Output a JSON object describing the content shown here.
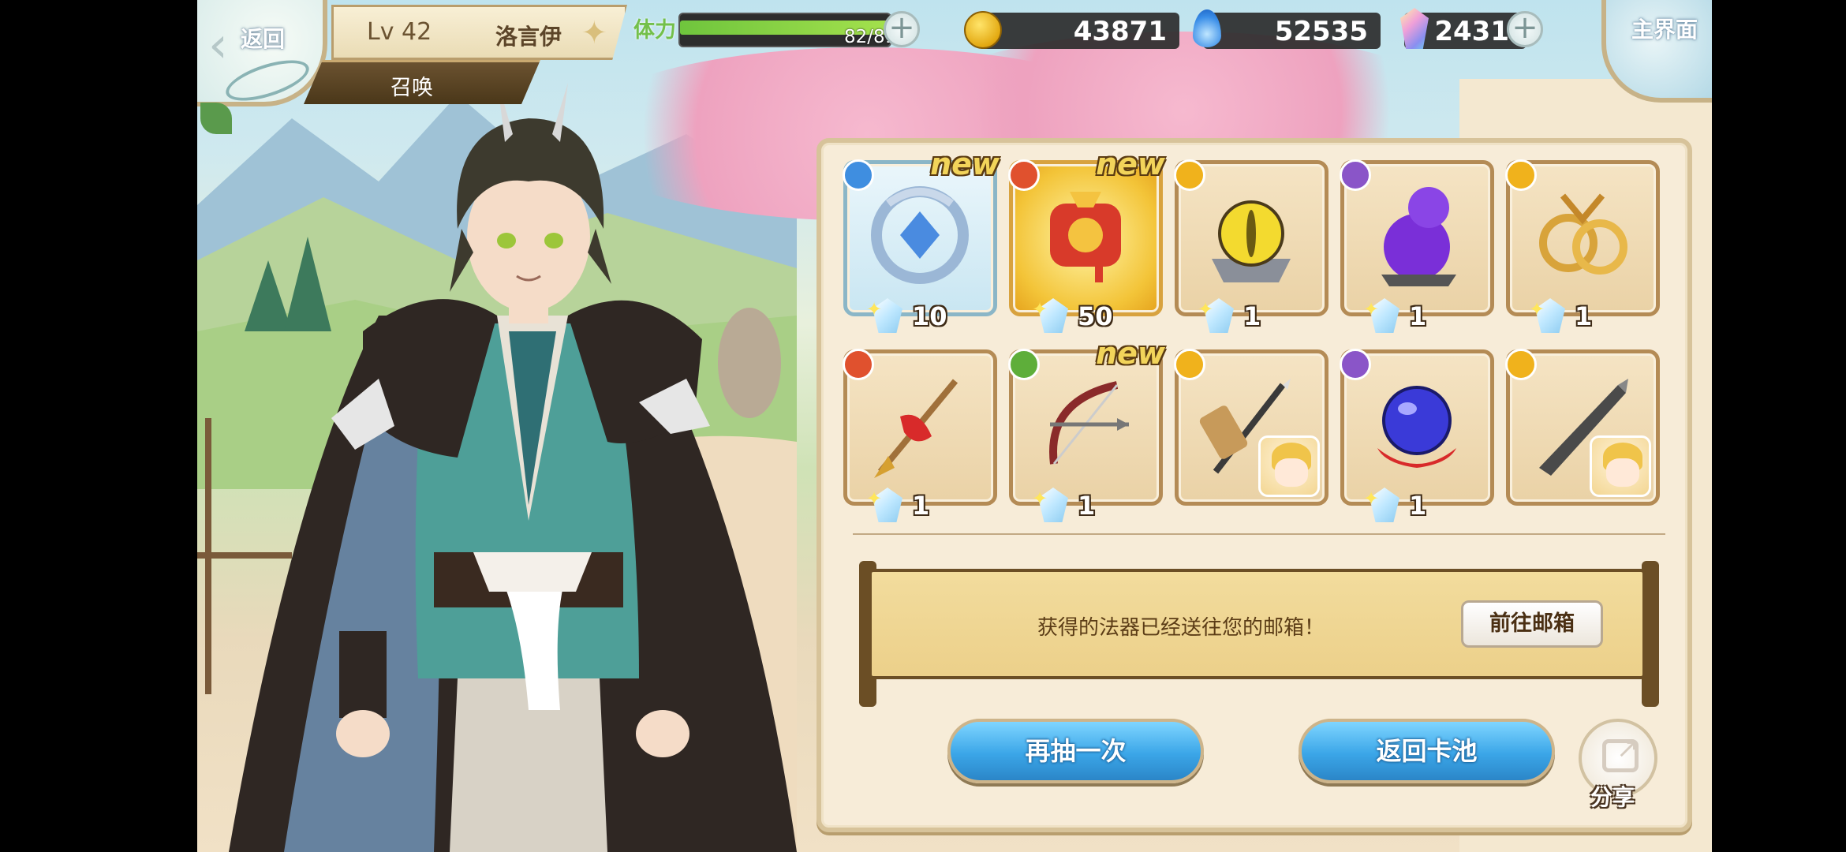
{
  "hud": {
    "back_label": "返回",
    "level": "Lv 42",
    "player_name": "洛言伊",
    "mode_tab": "召唤",
    "stamina_label": "体力",
    "stamina_value": "82/81",
    "stamina_fraction": 1.0,
    "gold": "43871",
    "spirit": "52535",
    "crystal": "2431",
    "home_label": "主界面"
  },
  "results": [
    {
      "qty": "10",
      "new": true,
      "new_label": "new",
      "element": "water",
      "element_color": "#3f8ee0",
      "icon": "dragon-ring-icon",
      "frame": "blue"
    },
    {
      "qty": "50",
      "new": true,
      "new_label": "new",
      "element": "fire",
      "element_color": "#e0512e",
      "icon": "red-scroll-icon",
      "frame": "gold"
    },
    {
      "qty": "1",
      "new": false,
      "new_label": "",
      "element": "light",
      "element_color": "#f0b21c",
      "icon": "yellow-orb-icon",
      "frame": "normal"
    },
    {
      "qty": "1",
      "new": false,
      "new_label": "",
      "element": "dark",
      "element_color": "#8a55c8",
      "icon": "purple-gourd-icon",
      "frame": "normal"
    },
    {
      "qty": "1",
      "new": false,
      "new_label": "",
      "element": "light",
      "element_color": "#f0b21c",
      "icon": "gold-rings-icon",
      "frame": "normal"
    },
    {
      "qty": "1",
      "new": false,
      "new_label": "",
      "element": "fire",
      "element_color": "#e0512e",
      "icon": "spear-icon",
      "frame": "normal"
    },
    {
      "qty": "1",
      "new": true,
      "new_label": "new",
      "element": "wind",
      "element_color": "#5eae3a",
      "icon": "bow-icon",
      "frame": "normal"
    },
    {
      "qty": "",
      "new": false,
      "new_label": "",
      "element": "light",
      "element_color": "#f0b21c",
      "icon": "dagger-icon",
      "frame": "normal",
      "chibi": true
    },
    {
      "qty": "1",
      "new": false,
      "new_label": "",
      "element": "dark",
      "element_color": "#8a55c8",
      "icon": "blue-orb-icon",
      "frame": "normal"
    },
    {
      "qty": "",
      "new": false,
      "new_label": "",
      "element": "light",
      "element_color": "#f0b21c",
      "icon": "blade-icon",
      "frame": "normal",
      "chibi": true
    }
  ],
  "notice": {
    "message": "获得的法器已经送往您的邮箱！",
    "mail_button": "前往邮箱"
  },
  "actions": {
    "draw_again": "再抽一次",
    "back_to_pool": "返回卡池",
    "share": "分享"
  },
  "colors": {
    "accent_blue": "#3ba6e8",
    "panel_bg": "#f7ecd8",
    "frame_brown": "#b48b55"
  }
}
